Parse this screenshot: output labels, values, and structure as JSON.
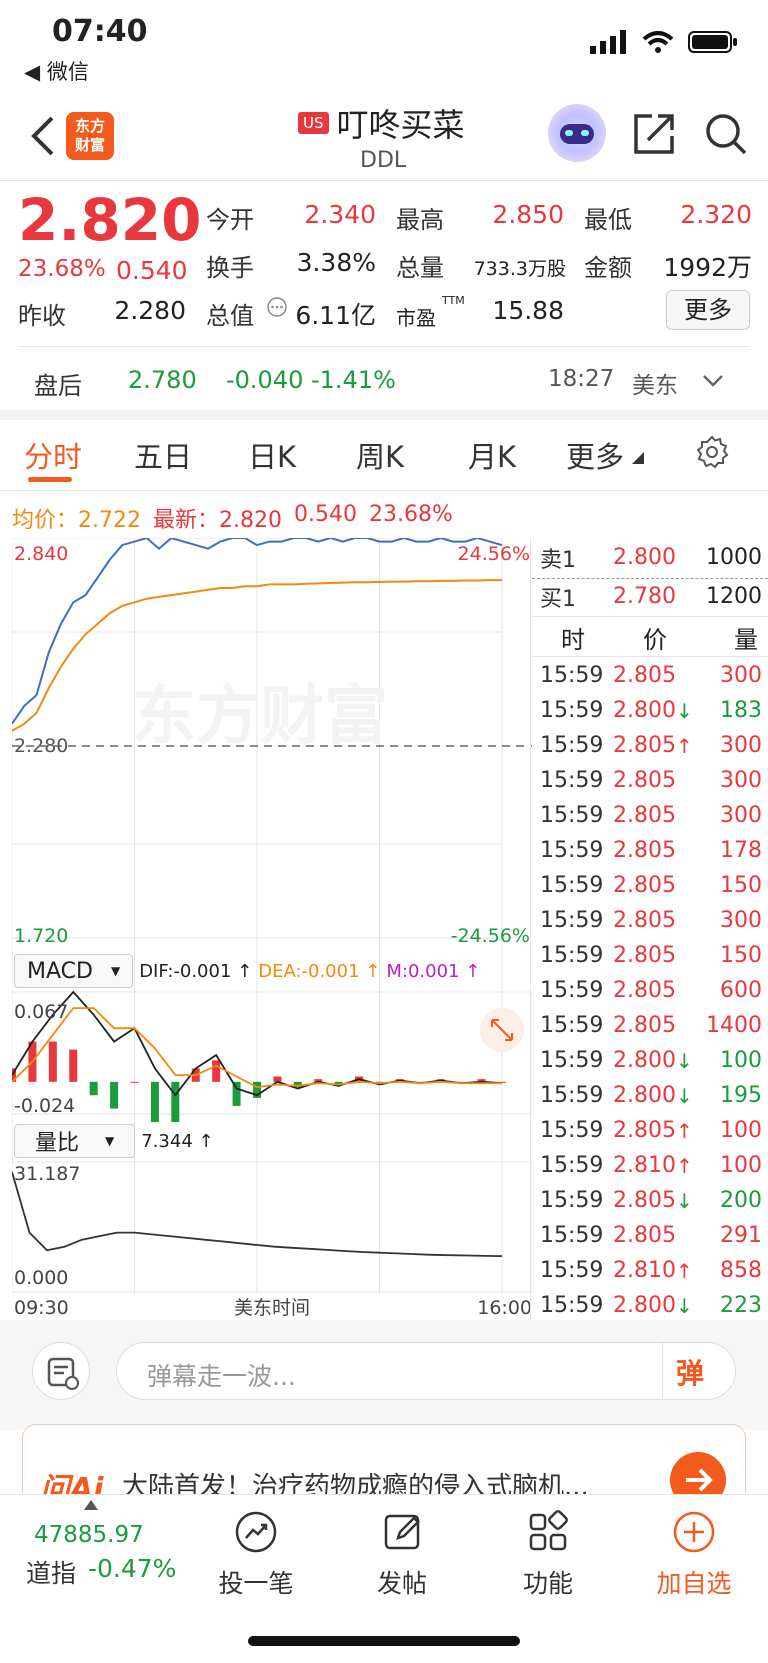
{
  "status_bar": {
    "time": "07:40",
    "back_app": "◀ 微信"
  },
  "header": {
    "logo_text_1": "东方",
    "logo_text_2": "财富",
    "market_badge": "US",
    "name": "叮咚买菜",
    "code": "DDL"
  },
  "quote": {
    "price": "2.820",
    "change_pct": "23.68%",
    "change_abs": "0.540",
    "fields": [
      {
        "label": "今开",
        "value": "2.340",
        "color": "#e8383d"
      },
      {
        "label": "最高",
        "value": "2.850",
        "color": "#e8383d"
      },
      {
        "label": "最低",
        "value": "2.320",
        "color": "#e8383d"
      },
      {
        "label": "换手",
        "value": "3.38%",
        "color": "#222222"
      },
      {
        "label": "总量",
        "value": "733.3万股",
        "color": "#222222"
      },
      {
        "label": "金额",
        "value": "1992万",
        "color": "#222222"
      },
      {
        "label": "昨收",
        "value": "2.280",
        "color": "#222222"
      },
      {
        "label": "总值",
        "value": "6.11亿",
        "color": "#222222"
      },
      {
        "label": "市盈",
        "value": "15.88",
        "color": "#222222"
      }
    ],
    "ttm_tag": "TTM",
    "more_label": "更多"
  },
  "after_hours": {
    "label": "盘后",
    "price": "2.780",
    "change": "-0.040 -1.41%",
    "time": "18:27",
    "market": "美东"
  },
  "tabs": [
    {
      "label": "分时",
      "active": true
    },
    {
      "label": "五日",
      "active": false
    },
    {
      "label": "日K",
      "active": false
    },
    {
      "label": "周K",
      "active": false
    },
    {
      "label": "月K",
      "active": false
    },
    {
      "label": "更多",
      "active": false
    }
  ],
  "info_line": {
    "avg_label": "均价：",
    "avg_value": "2.722",
    "latest_label": "最新：",
    "latest_value": "2.820",
    "latest_chg": "0.540",
    "latest_pct": "23.68%"
  },
  "chart_data": {
    "type": "line",
    "y_top_label": "2.840",
    "y_mid_label": "2.280",
    "y_bottom_label": "1.720",
    "pct_top_label": "24.56%",
    "pct_bottom_label": "-24.56%",
    "ylim": [
      1.72,
      2.84
    ],
    "x_start": "09:30",
    "x_mid": "美东时间",
    "x_end": "16:00",
    "watermark": "东方财富",
    "series": [
      {
        "values": [
          2.32,
          2.37,
          2.4,
          2.52,
          2.6,
          2.66,
          2.68,
          2.73,
          2.78,
          2.82,
          2.83,
          2.84,
          2.81,
          2.84,
          2.83,
          2.82,
          2.81,
          2.83,
          2.84,
          2.84,
          2.82,
          2.83,
          2.83,
          2.84,
          2.84,
          2.83,
          2.84,
          2.83,
          2.84,
          2.84,
          2.83,
          2.83,
          2.84,
          2.83,
          2.83,
          2.84,
          2.83,
          2.83,
          2.84,
          2.83,
          2.82
        ],
        "color": "#3a6fc4"
      },
      {
        "values": [
          2.3,
          2.32,
          2.35,
          2.42,
          2.48,
          2.53,
          2.57,
          2.6,
          2.63,
          2.65,
          2.66,
          2.67,
          2.675,
          2.68,
          2.685,
          2.69,
          2.695,
          2.7,
          2.7,
          2.705,
          2.705,
          2.71,
          2.71,
          2.71,
          2.712,
          2.713,
          2.714,
          2.715,
          2.716,
          2.716,
          2.717,
          2.718,
          2.718,
          2.719,
          2.719,
          2.72,
          2.72,
          2.721,
          2.721,
          2.722,
          2.722
        ],
        "color": "#f08a10"
      }
    ],
    "macd": {
      "label": "MACD",
      "dif": "DIF:-0.001 ↑",
      "dea": "DEA:-0.001 ↑",
      "m": "M:0.001 ↑",
      "top_label": "0.067",
      "bottom_label": "-0.024",
      "dif_values": [
        0.005,
        0.03,
        0.05,
        0.067,
        0.05,
        0.03,
        0.04,
        0.01,
        -0.01,
        0.01,
        0.02,
        -0.005,
        -0.01,
        0.0,
        -0.005,
        0.0,
        -0.003,
        0.002,
        -0.002,
        0.001,
        -0.001,
        0.001,
        -0.001,
        0.0,
        -0.001
      ],
      "dea_values": [
        0.0,
        0.015,
        0.035,
        0.055,
        0.055,
        0.04,
        0.04,
        0.025,
        0.005,
        0.005,
        0.012,
        0.004,
        -0.004,
        -0.002,
        -0.003,
        -0.001,
        -0.002,
        0.0,
        -0.001,
        0.0,
        -0.001,
        0.0,
        -0.001,
        -0.001,
        -0.001
      ]
    },
    "volume_ratio": {
      "label": "量比",
      "value": "7.344 ↑",
      "top_label": "31.187",
      "bottom_label": "0.000",
      "values": [
        31.187,
        14,
        9,
        10,
        12,
        13,
        14,
        14,
        13.5,
        13,
        12.5,
        12,
        11.5,
        11,
        10.5,
        10,
        9.7,
        9.4,
        9.1,
        8.8,
        8.5,
        8.3,
        8.1,
        7.9,
        7.7,
        7.6,
        7.5,
        7.4,
        7.344
      ]
    }
  },
  "order_book": {
    "ask": {
      "label": "卖1",
      "price": "2.800",
      "qty": "1000"
    },
    "bid": {
      "label": "买1",
      "price": "2.780",
      "qty": "1200"
    },
    "headers": [
      "时",
      "价",
      "量"
    ],
    "trades": [
      {
        "time": "15:59",
        "price": "2.805",
        "dir": "",
        "qty": "300",
        "qtycolor": "#e8383d"
      },
      {
        "time": "15:59",
        "price": "2.800",
        "dir": "↓",
        "qty": "183",
        "qtycolor": "#1a9b3c"
      },
      {
        "time": "15:59",
        "price": "2.805",
        "dir": "↑",
        "qty": "300",
        "qtycolor": "#e8383d"
      },
      {
        "time": "15:59",
        "price": "2.805",
        "dir": "",
        "qty": "300",
        "qtycolor": "#e8383d"
      },
      {
        "time": "15:59",
        "price": "2.805",
        "dir": "",
        "qty": "300",
        "qtycolor": "#e8383d"
      },
      {
        "time": "15:59",
        "price": "2.805",
        "dir": "",
        "qty": "178",
        "qtycolor": "#e8383d"
      },
      {
        "time": "15:59",
        "price": "2.805",
        "dir": "",
        "qty": "150",
        "qtycolor": "#e8383d"
      },
      {
        "time": "15:59",
        "price": "2.805",
        "dir": "",
        "qty": "300",
        "qtycolor": "#e8383d"
      },
      {
        "time": "15:59",
        "price": "2.805",
        "dir": "",
        "qty": "150",
        "qtycolor": "#e8383d"
      },
      {
        "time": "15:59",
        "price": "2.805",
        "dir": "",
        "qty": "600",
        "qtycolor": "#e8383d"
      },
      {
        "time": "15:59",
        "price": "2.805",
        "dir": "",
        "qty": "1400",
        "qtycolor": "#e8383d"
      },
      {
        "time": "15:59",
        "price": "2.800",
        "dir": "↓",
        "qty": "100",
        "qtycolor": "#1a9b3c"
      },
      {
        "time": "15:59",
        "price": "2.800",
        "dir": "↓",
        "qty": "195",
        "qtycolor": "#1a9b3c"
      },
      {
        "time": "15:59",
        "price": "2.805",
        "dir": "↑",
        "qty": "100",
        "qtycolor": "#e8383d"
      },
      {
        "time": "15:59",
        "price": "2.810",
        "dir": "↑",
        "qty": "100",
        "qtycolor": "#e8383d"
      },
      {
        "time": "15:59",
        "price": "2.805",
        "dir": "↓",
        "qty": "200",
        "qtycolor": "#1a9b3c"
      },
      {
        "time": "15:59",
        "price": "2.805",
        "dir": "",
        "qty": "291",
        "qtycolor": "#e8383d"
      },
      {
        "time": "15:59",
        "price": "2.810",
        "dir": "↑",
        "qty": "858",
        "qtycolor": "#e8383d"
      },
      {
        "time": "15:59",
        "price": "2.800",
        "dir": "↓",
        "qty": "223",
        "qtycolor": "#1a9b3c"
      }
    ]
  },
  "danmu": {
    "placeholder": "弹幕走一波...",
    "button": "弹"
  },
  "ai_banner": {
    "logo": "问Ai",
    "text": "大陆首发！治疗药物成瘾的侵入式脑机..."
  },
  "bottom_nav": {
    "index_value": "47885.97",
    "index_name": "道指",
    "index_change": "-0.47%",
    "items": [
      {
        "label": "投一笔",
        "icon": "trend-circle-icon"
      },
      {
        "label": "发帖",
        "icon": "edit-icon"
      },
      {
        "label": "功能",
        "icon": "grid-icon"
      },
      {
        "label": "加自选",
        "icon": "plus-circle-icon"
      }
    ]
  },
  "colors": {
    "up": "#e8383d",
    "down": "#1a9b3c",
    "accent": "#f25a1e",
    "avg_line": "#f08a10",
    "price_line": "#3a6fc4"
  }
}
